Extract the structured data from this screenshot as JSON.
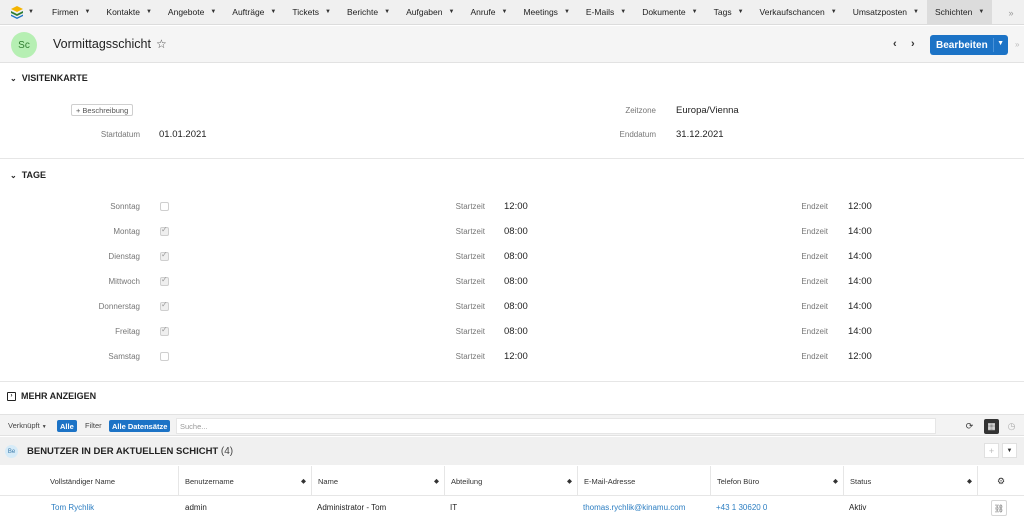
{
  "nav": {
    "items": [
      {
        "label": "Firmen"
      },
      {
        "label": "Kontakte"
      },
      {
        "label": "Angebote"
      },
      {
        "label": "Aufträge"
      },
      {
        "label": "Tickets"
      },
      {
        "label": "Berichte"
      },
      {
        "label": "Aufgaben"
      },
      {
        "label": "Anrufe"
      },
      {
        "label": "Meetings"
      },
      {
        "label": "E-Mails"
      },
      {
        "label": "Dokumente"
      },
      {
        "label": "Tags"
      },
      {
        "label": "Verkaufschancen"
      },
      {
        "label": "Umsatzposten"
      },
      {
        "label": "Schichten"
      }
    ],
    "more_icon": "chevron-double-right-icon"
  },
  "record": {
    "avatar": "Sc",
    "title": "Vormittagsschicht",
    "edit_label": "Bearbeiten",
    "avatar_color": "#b6efb3",
    "accent": "#1c73c6"
  },
  "visitenkarte": {
    "heading": "VISITENKARTE",
    "description_button": "Beschreibung",
    "zeitzone_label": "Zeitzone",
    "zeitzone_value": "Europa/Vienna",
    "startdatum_label": "Startdatum",
    "startdatum_value": "01.01.2021",
    "enddatum_label": "Enddatum",
    "enddatum_value": "31.12.2021"
  },
  "tage": {
    "heading": "TAGE",
    "start_label": "Startzeit",
    "end_label": "Endzeit",
    "days": [
      {
        "name": "Sonntag",
        "checked": false,
        "start": "12:00",
        "end": "12:00"
      },
      {
        "name": "Montag",
        "checked": true,
        "start": "08:00",
        "end": "14:00"
      },
      {
        "name": "Dienstag",
        "checked": true,
        "start": "08:00",
        "end": "14:00"
      },
      {
        "name": "Mittwoch",
        "checked": true,
        "start": "08:00",
        "end": "14:00"
      },
      {
        "name": "Donnerstag",
        "checked": true,
        "start": "08:00",
        "end": "14:00"
      },
      {
        "name": "Freitag",
        "checked": true,
        "start": "08:00",
        "end": "14:00"
      },
      {
        "name": "Samstag",
        "checked": false,
        "start": "12:00",
        "end": "12:00"
      }
    ]
  },
  "more": {
    "label": "MEHR ANZEIGEN"
  },
  "filter": {
    "linked_label": "Verknüpft",
    "linked_value": "Alle",
    "filter_label": "Filter",
    "filter_value": "Alle Datensätze",
    "search_placeholder": "Suche..."
  },
  "list": {
    "badge": "Be",
    "title": "BENUTZER IN DER AKTUELLEN SCHICHT",
    "count": "(4)",
    "columns": [
      "Vollständiger Name",
      "Benutzername",
      "Name",
      "Abteilung",
      "E-Mail-Adresse",
      "Telefon Büro",
      "Status"
    ],
    "rows": [
      {
        "full_name": "Tom Rychlik",
        "username": "admin",
        "name": "Administrator - Tom",
        "department": "IT",
        "email": "thomas.rychlik@kinamu.com",
        "phone": "+43 1 30620 0",
        "status": "Aktiv"
      }
    ]
  }
}
